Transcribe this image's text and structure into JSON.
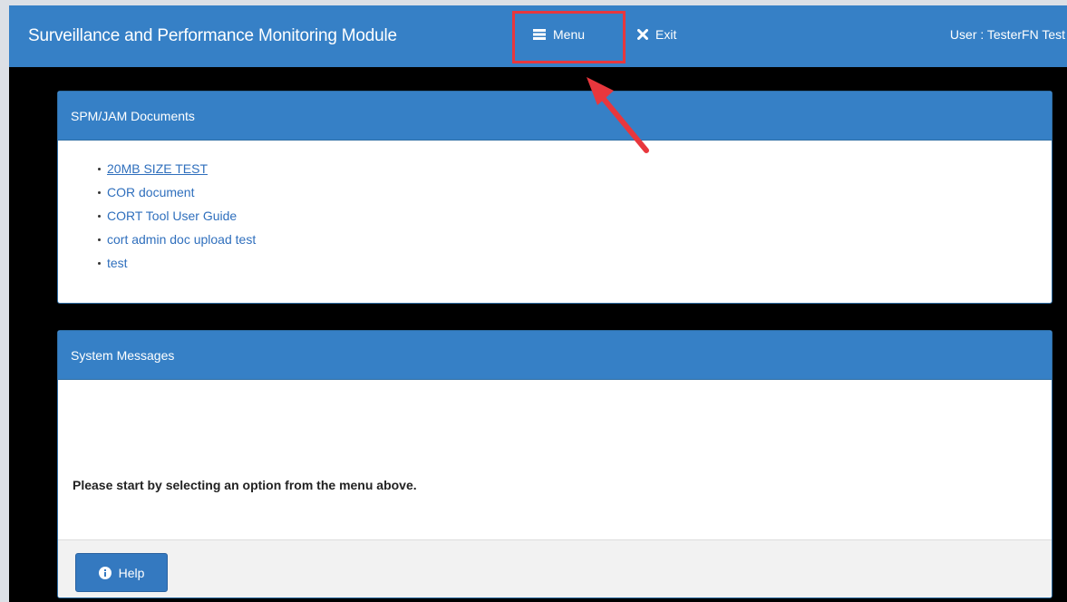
{
  "navbar": {
    "brand": "Surveillance and Performance Monitoring Module",
    "menu_label": "Menu",
    "exit_label": "Exit",
    "user_label": "User : TesterFN Test"
  },
  "documents_panel": {
    "title": "SPM/JAM Documents",
    "items": [
      "20MB SIZE TEST",
      "COR document",
      "CORT Tool User Guide",
      "cort admin doc upload test",
      "test"
    ]
  },
  "messages_panel": {
    "title": "System Messages",
    "message": "Please start by selecting an option from the menu above.",
    "help_label": "Help"
  },
  "colors": {
    "navbar": "#3680c6",
    "link": "#2f6fbd",
    "annotation": "#e8373d",
    "background": "#000000"
  },
  "icons": {
    "menu": "list-icon",
    "exit": "close-icon",
    "help": "info-icon"
  }
}
